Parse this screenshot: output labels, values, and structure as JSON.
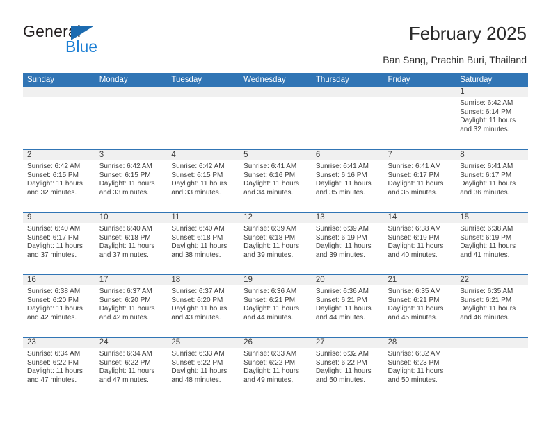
{
  "logo": {
    "word_one": "General",
    "word_two": "Blue",
    "flag_icon": "blue-triangle-flag",
    "color_dark": "#231f20",
    "color_blue": "#1c7fd4"
  },
  "header": {
    "title": "February 2025",
    "subtitle": "Ban Sang, Prachin Buri, Thailand"
  },
  "theme": {
    "header_blue": "#3175b5",
    "daynum_band": "#f0f0f0",
    "text": "#3c3c3c"
  },
  "calendar": {
    "weekday_headers": [
      "Sunday",
      "Monday",
      "Tuesday",
      "Wednesday",
      "Thursday",
      "Friday",
      "Saturday"
    ],
    "weeks": [
      [
        {
          "day": "",
          "sunrise": "",
          "sunset": "",
          "daylight": ""
        },
        {
          "day": "",
          "sunrise": "",
          "sunset": "",
          "daylight": ""
        },
        {
          "day": "",
          "sunrise": "",
          "sunset": "",
          "daylight": ""
        },
        {
          "day": "",
          "sunrise": "",
          "sunset": "",
          "daylight": ""
        },
        {
          "day": "",
          "sunrise": "",
          "sunset": "",
          "daylight": ""
        },
        {
          "day": "",
          "sunrise": "",
          "sunset": "",
          "daylight": ""
        },
        {
          "day": "1",
          "sunrise": "Sunrise: 6:42 AM",
          "sunset": "Sunset: 6:14 PM",
          "daylight": "Daylight: 11 hours and 32 minutes."
        }
      ],
      [
        {
          "day": "2",
          "sunrise": "Sunrise: 6:42 AM",
          "sunset": "Sunset: 6:15 PM",
          "daylight": "Daylight: 11 hours and 32 minutes."
        },
        {
          "day": "3",
          "sunrise": "Sunrise: 6:42 AM",
          "sunset": "Sunset: 6:15 PM",
          "daylight": "Daylight: 11 hours and 33 minutes."
        },
        {
          "day": "4",
          "sunrise": "Sunrise: 6:42 AM",
          "sunset": "Sunset: 6:15 PM",
          "daylight": "Daylight: 11 hours and 33 minutes."
        },
        {
          "day": "5",
          "sunrise": "Sunrise: 6:41 AM",
          "sunset": "Sunset: 6:16 PM",
          "daylight": "Daylight: 11 hours and 34 minutes."
        },
        {
          "day": "6",
          "sunrise": "Sunrise: 6:41 AM",
          "sunset": "Sunset: 6:16 PM",
          "daylight": "Daylight: 11 hours and 35 minutes."
        },
        {
          "day": "7",
          "sunrise": "Sunrise: 6:41 AM",
          "sunset": "Sunset: 6:17 PM",
          "daylight": "Daylight: 11 hours and 35 minutes."
        },
        {
          "day": "8",
          "sunrise": "Sunrise: 6:41 AM",
          "sunset": "Sunset: 6:17 PM",
          "daylight": "Daylight: 11 hours and 36 minutes."
        }
      ],
      [
        {
          "day": "9",
          "sunrise": "Sunrise: 6:40 AM",
          "sunset": "Sunset: 6:17 PM",
          "daylight": "Daylight: 11 hours and 37 minutes."
        },
        {
          "day": "10",
          "sunrise": "Sunrise: 6:40 AM",
          "sunset": "Sunset: 6:18 PM",
          "daylight": "Daylight: 11 hours and 37 minutes."
        },
        {
          "day": "11",
          "sunrise": "Sunrise: 6:40 AM",
          "sunset": "Sunset: 6:18 PM",
          "daylight": "Daylight: 11 hours and 38 minutes."
        },
        {
          "day": "12",
          "sunrise": "Sunrise: 6:39 AM",
          "sunset": "Sunset: 6:18 PM",
          "daylight": "Daylight: 11 hours and 39 minutes."
        },
        {
          "day": "13",
          "sunrise": "Sunrise: 6:39 AM",
          "sunset": "Sunset: 6:19 PM",
          "daylight": "Daylight: 11 hours and 39 minutes."
        },
        {
          "day": "14",
          "sunrise": "Sunrise: 6:38 AM",
          "sunset": "Sunset: 6:19 PM",
          "daylight": "Daylight: 11 hours and 40 minutes."
        },
        {
          "day": "15",
          "sunrise": "Sunrise: 6:38 AM",
          "sunset": "Sunset: 6:19 PM",
          "daylight": "Daylight: 11 hours and 41 minutes."
        }
      ],
      [
        {
          "day": "16",
          "sunrise": "Sunrise: 6:38 AM",
          "sunset": "Sunset: 6:20 PM",
          "daylight": "Daylight: 11 hours and 42 minutes."
        },
        {
          "day": "17",
          "sunrise": "Sunrise: 6:37 AM",
          "sunset": "Sunset: 6:20 PM",
          "daylight": "Daylight: 11 hours and 42 minutes."
        },
        {
          "day": "18",
          "sunrise": "Sunrise: 6:37 AM",
          "sunset": "Sunset: 6:20 PM",
          "daylight": "Daylight: 11 hours and 43 minutes."
        },
        {
          "day": "19",
          "sunrise": "Sunrise: 6:36 AM",
          "sunset": "Sunset: 6:21 PM",
          "daylight": "Daylight: 11 hours and 44 minutes."
        },
        {
          "day": "20",
          "sunrise": "Sunrise: 6:36 AM",
          "sunset": "Sunset: 6:21 PM",
          "daylight": "Daylight: 11 hours and 44 minutes."
        },
        {
          "day": "21",
          "sunrise": "Sunrise: 6:35 AM",
          "sunset": "Sunset: 6:21 PM",
          "daylight": "Daylight: 11 hours and 45 minutes."
        },
        {
          "day": "22",
          "sunrise": "Sunrise: 6:35 AM",
          "sunset": "Sunset: 6:21 PM",
          "daylight": "Daylight: 11 hours and 46 minutes."
        }
      ],
      [
        {
          "day": "23",
          "sunrise": "Sunrise: 6:34 AM",
          "sunset": "Sunset: 6:22 PM",
          "daylight": "Daylight: 11 hours and 47 minutes."
        },
        {
          "day": "24",
          "sunrise": "Sunrise: 6:34 AM",
          "sunset": "Sunset: 6:22 PM",
          "daylight": "Daylight: 11 hours and 47 minutes."
        },
        {
          "day": "25",
          "sunrise": "Sunrise: 6:33 AM",
          "sunset": "Sunset: 6:22 PM",
          "daylight": "Daylight: 11 hours and 48 minutes."
        },
        {
          "day": "26",
          "sunrise": "Sunrise: 6:33 AM",
          "sunset": "Sunset: 6:22 PM",
          "daylight": "Daylight: 11 hours and 49 minutes."
        },
        {
          "day": "27",
          "sunrise": "Sunrise: 6:32 AM",
          "sunset": "Sunset: 6:22 PM",
          "daylight": "Daylight: 11 hours and 50 minutes."
        },
        {
          "day": "28",
          "sunrise": "Sunrise: 6:32 AM",
          "sunset": "Sunset: 6:23 PM",
          "daylight": "Daylight: 11 hours and 50 minutes."
        },
        {
          "day": "",
          "sunrise": "",
          "sunset": "",
          "daylight": ""
        }
      ]
    ]
  }
}
